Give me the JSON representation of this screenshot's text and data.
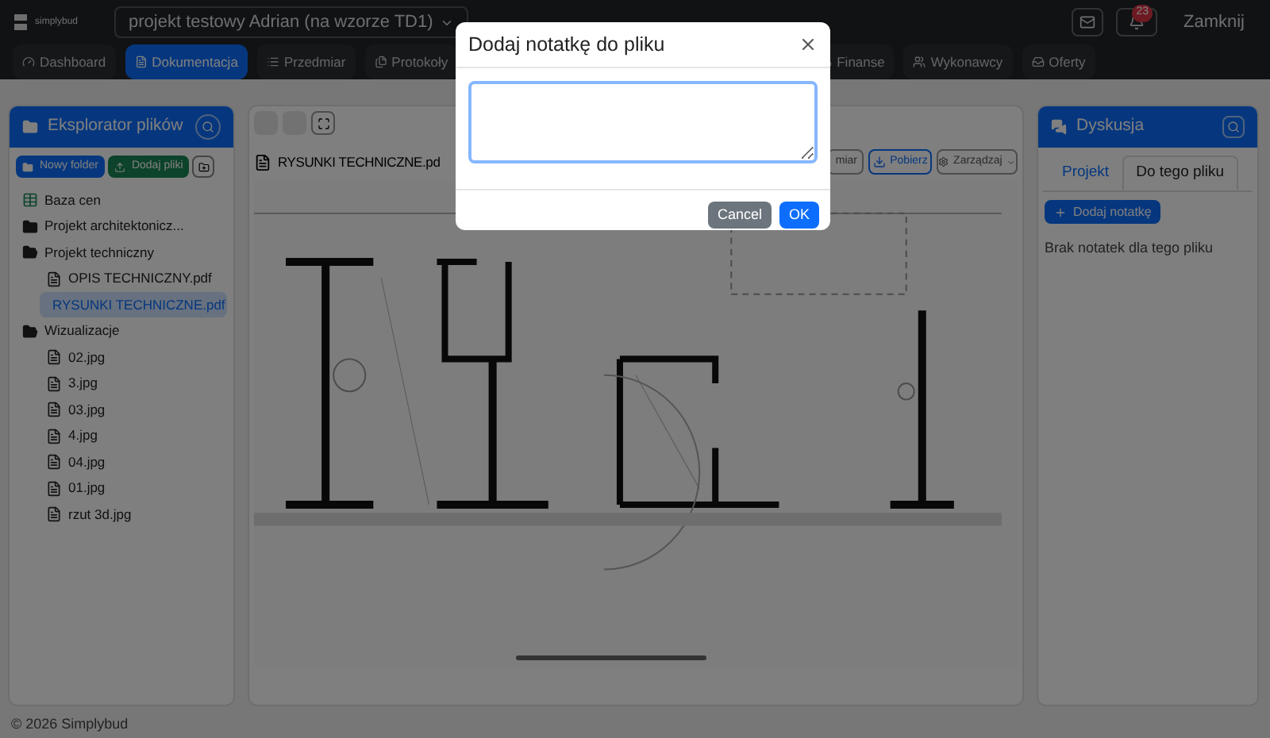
{
  "brand": {
    "name": "simplybud"
  },
  "project_select": {
    "value": "projekt testowy Adrian (na wzorze TD1)"
  },
  "header_actions": {
    "notifications": "23",
    "logout": "Zamknij"
  },
  "nav_left": [
    {
      "label": "Dashboard",
      "selected": false
    },
    {
      "label": "Dokumentacja",
      "selected": true
    },
    {
      "label": "Przedmiar",
      "selected": false
    },
    {
      "label": "Protokoły",
      "selected": false
    }
  ],
  "nav_right": [
    {
      "label": "Finanse",
      "selected": false
    },
    {
      "label": "Wykonawcy",
      "selected": false
    },
    {
      "label": "Oferty",
      "selected": false
    }
  ],
  "explorer": {
    "title": "Eksplorator plików",
    "buttons": [
      "Nowy folder",
      "Dodaj pliki"
    ],
    "tree": [
      {
        "kind": "table",
        "label": "Baza cen",
        "selected": false
      },
      {
        "kind": "folder",
        "label": "Projekt architektonicz...",
        "expanded": false,
        "selected": false
      },
      {
        "kind": "folder",
        "label": "Projekt techniczny",
        "expanded": true,
        "selected": false,
        "children": [
          {
            "kind": "file",
            "label": "OPIS TECHNICZNY.pdf",
            "selected": false
          },
          {
            "kind": "file",
            "label": "RYSUNKI TECHNICZNE.pdf",
            "selected": true
          }
        ]
      },
      {
        "kind": "folder",
        "label": "Wizualizacje",
        "expanded": true,
        "selected": false,
        "children": [
          {
            "kind": "file",
            "label": "02.jpg",
            "selected": false
          },
          {
            "kind": "file",
            "label": "3.jpg",
            "selected": false
          },
          {
            "kind": "file",
            "label": "03.jpg",
            "selected": false
          },
          {
            "kind": "file",
            "label": "4.jpg",
            "selected": false
          },
          {
            "kind": "file",
            "label": "04.jpg",
            "selected": false
          },
          {
            "kind": "file",
            "label": "01.jpg",
            "selected": false
          },
          {
            "kind": "file",
            "label": "rzut 3d.jpg",
            "selected": false
          }
        ]
      }
    ]
  },
  "viewer": {
    "file_title": "RYSUNKI TECHNICZNE.pd",
    "buttons": [
      {
        "kind": "outline",
        "label": "miar"
      },
      {
        "kind": "download",
        "label": "Pobierz"
      },
      {
        "kind": "dropdown",
        "label": "Zarządzaj"
      }
    ]
  },
  "discussion": {
    "title": "Dyskusja",
    "tabs": [
      {
        "label": "Projekt",
        "selected": false
      },
      {
        "label": "Do tego pliku",
        "selected": true
      }
    ],
    "add_button": "Dodaj notatkę",
    "empty": "Brak notatek dla tego pliku"
  },
  "footer": "© 2026 Simplybud",
  "modal": {
    "title": "Dodaj notatkę do pliku",
    "buttons": [
      {
        "kind": "secondary",
        "label": "Cancel"
      },
      {
        "kind": "primary",
        "label": "OK"
      }
    ]
  }
}
